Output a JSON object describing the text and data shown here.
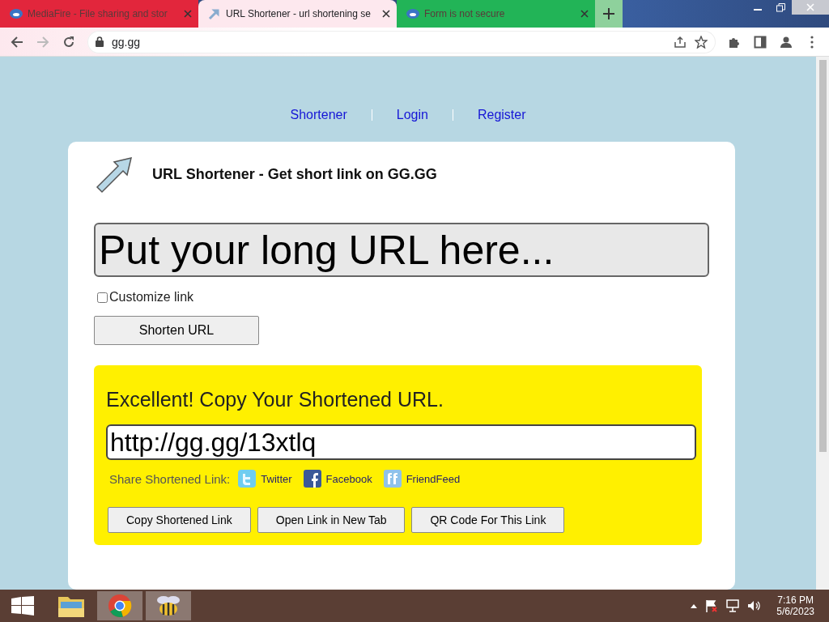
{
  "browser": {
    "tabs": [
      {
        "title": "MediaFire - File sharing and stor",
        "selected": false,
        "color": "#e2263c"
      },
      {
        "title": "URL Shortener - url shortening se",
        "selected": true,
        "color": "#fde8ee"
      },
      {
        "title": "Form is not secure",
        "selected": false,
        "color": "#22b457"
      }
    ],
    "address": "gg.gg"
  },
  "nav": [
    "Shortener",
    "Login",
    "Register"
  ],
  "card": {
    "title": "URL Shortener - Get short link on GG.GG",
    "url_field": {
      "placeholder": "Put your long URL here..."
    },
    "customize": {
      "label": "Customize link",
      "checked": false
    },
    "submit": "Shorten URL",
    "result": {
      "heading": "Excellent! Copy Your Shortened URL.",
      "short_url": "http://gg.gg/13xtlq",
      "share_label": "Share Shortened Link:",
      "share_links": [
        {
          "kind": "twitter",
          "label": "Twitter"
        },
        {
          "kind": "facebook",
          "label": "Facebook"
        },
        {
          "kind": "friendfeed",
          "label": "FriendFeed"
        }
      ],
      "buttons": [
        "Copy Shortened Link",
        "Open Link in New Tab",
        "QR Code For This Link"
      ]
    }
  },
  "taskbar": {
    "time": "7:16 PM",
    "date": "5/6/2023"
  }
}
